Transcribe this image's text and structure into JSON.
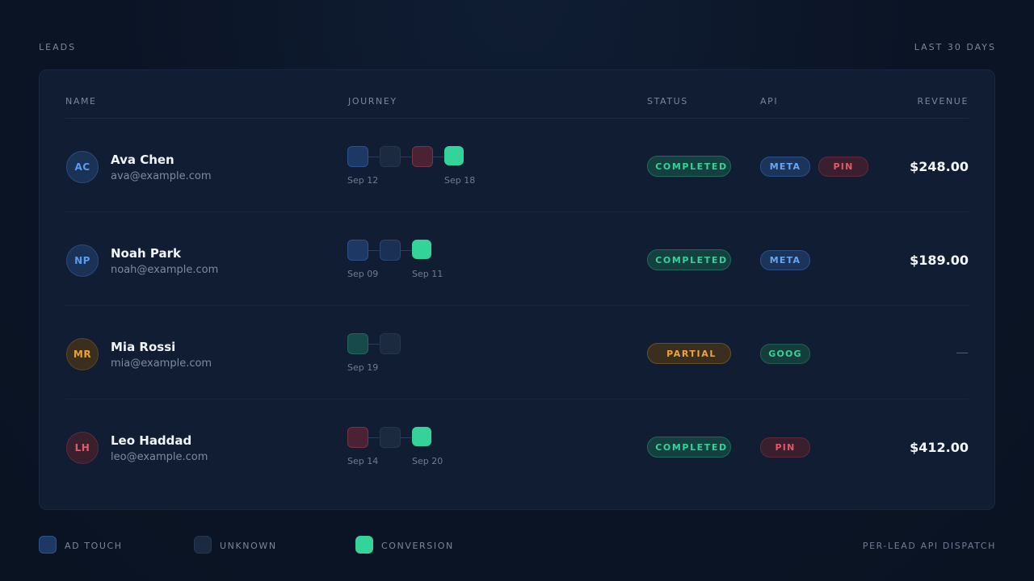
{
  "header": {
    "section_label": "LEADS",
    "range_label": "LAST 30 DAYS"
  },
  "table": {
    "columns": {
      "name": "NAME",
      "journey": "JOURNEY",
      "status": "STATUS",
      "api": "API",
      "revenue": "REVENUE"
    },
    "rows": [
      {
        "initials": "AC",
        "name": "Ava Chen",
        "email": "ava@example.com",
        "journey_dates": [
          "Sep 12",
          "Sep 18"
        ],
        "status": "COMPLETED",
        "apis": [
          "META",
          "PIN"
        ],
        "revenue": "$248.00"
      },
      {
        "initials": "NP",
        "name": "Noah Park",
        "email": "noah@example.com",
        "journey_dates": [
          "Sep 09",
          "Sep 11"
        ],
        "status": "COMPLETED",
        "apis": [
          "META"
        ],
        "revenue": "$189.00"
      },
      {
        "initials": "MR",
        "name": "Mia Rossi",
        "email": "mia@example.com",
        "journey_dates": [
          "Sep 19"
        ],
        "status": "PARTIAL",
        "apis": [
          "GOOG"
        ],
        "revenue": "—"
      },
      {
        "initials": "LH",
        "name": "Leo Haddad",
        "email": "leo@example.com",
        "journey_dates": [
          "Sep 14",
          "Sep 20"
        ],
        "status": "COMPLETED",
        "apis": [
          "PIN"
        ],
        "revenue": "$412.00"
      }
    ]
  },
  "legend": {
    "ad_touch": "AD TOUCH",
    "unknown": "UNKNOWN",
    "conversion": "CONVERSION"
  },
  "footer": {
    "note": "PER-LEAD API DISPATCH"
  },
  "colors": {
    "background": "#0b1425",
    "panel": "#111d33",
    "conversion": "#34d399",
    "ad_touch": "#1e3866",
    "unknown": "#1c2a3f",
    "partial": "#f0a33a",
    "pin": "#e8566a",
    "meta": "#6aa5f5"
  }
}
